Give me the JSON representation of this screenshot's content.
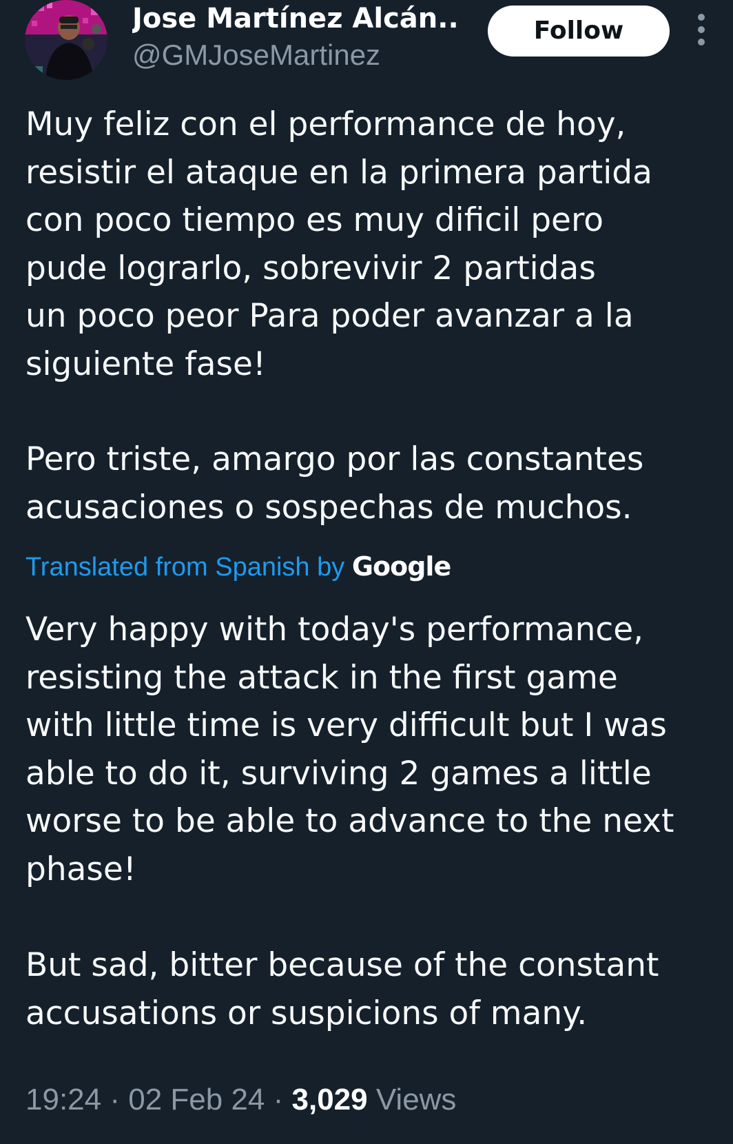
{
  "author": {
    "display_name": "Jose Martínez Alcán...",
    "handle": "@GMJoseMartinez",
    "avatar_icon": "profile-photo"
  },
  "follow_label": "Follow",
  "more_icon": "more-vertical-icon",
  "tweet": {
    "original_paragraph_1": "Muy feliz con el performance de hoy,\nresistir el ataque en la primera partida\ncon poco tiempo es muy dificil pero\npude lograrlo, sobrevivir 2 partidas\nun poco peor Para poder avanzar a la\nsiguiente fase!",
    "original_paragraph_2": "Pero triste, amargo por las constantes\nacusaciones o sospechas de muchos.",
    "translated_from": "Translated from Spanish by",
    "translation_provider": "Google",
    "translation_paragraph_1": "Very happy with today's performance,\nresisting the attack in the first game\nwith little time is very difficult but I was\nable to do it, surviving 2 games a little\nworse to be able to advance to the next\nphase!",
    "translation_paragraph_2": "But sad, bitter because of the constant\naccusations or suspicions of many."
  },
  "meta": {
    "time": "19:24",
    "separator": "·",
    "date": "02 Feb 24",
    "views_count": "3,029",
    "views_label": "Views"
  },
  "colors": {
    "background": "#15202b",
    "text": "#f7f9f9",
    "secondary": "#8b98a5",
    "link": "#1d9bf0"
  }
}
